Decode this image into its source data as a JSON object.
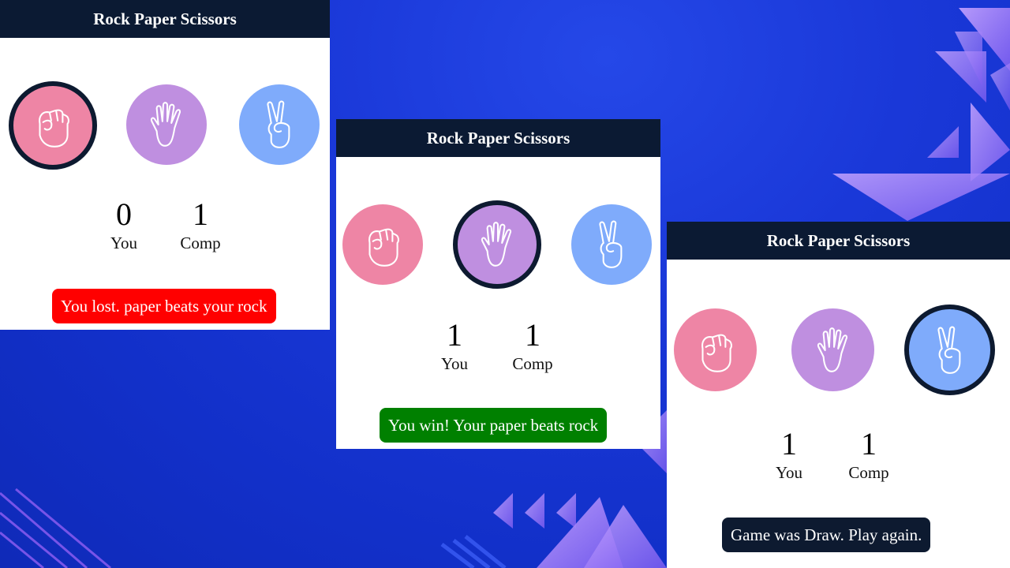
{
  "panels": [
    {
      "title": "Rock Paper Scissors",
      "choices": [
        {
          "name": "rock",
          "icon": "fist-icon",
          "selected": true
        },
        {
          "name": "paper",
          "icon": "open-hand-icon",
          "selected": false
        },
        {
          "name": "scissors",
          "icon": "peace-hand-icon",
          "selected": false
        }
      ],
      "score": {
        "you": "0",
        "comp": "1",
        "you_label": "You",
        "comp_label": "Comp"
      },
      "message": "You lost. paper beats your rock",
      "message_color": "#ff0000"
    },
    {
      "title": "Rock Paper Scissors",
      "choices": [
        {
          "name": "rock",
          "icon": "fist-icon",
          "selected": false
        },
        {
          "name": "paper",
          "icon": "open-hand-icon",
          "selected": true
        },
        {
          "name": "scissors",
          "icon": "peace-hand-icon",
          "selected": false
        }
      ],
      "score": {
        "you": "1",
        "comp": "1",
        "you_label": "You",
        "comp_label": "Comp"
      },
      "message": "You win! Your paper beats rock",
      "message_color": "#008000"
    },
    {
      "title": "Rock Paper Scissors",
      "choices": [
        {
          "name": "rock",
          "icon": "fist-icon",
          "selected": false
        },
        {
          "name": "paper",
          "icon": "open-hand-icon",
          "selected": false
        },
        {
          "name": "scissors",
          "icon": "peace-hand-icon",
          "selected": true
        }
      ],
      "score": {
        "you": "1",
        "comp": "1",
        "you_label": "You",
        "comp_label": "Comp"
      },
      "message": "Game was Draw. Play again.",
      "message_color": "#0d1a30"
    }
  ],
  "colors": {
    "header": "#0b1a33",
    "rock": "#ee85a5",
    "paper": "#bf8fe0",
    "scissors": "#7fabfb",
    "background": "#1a38d8"
  }
}
